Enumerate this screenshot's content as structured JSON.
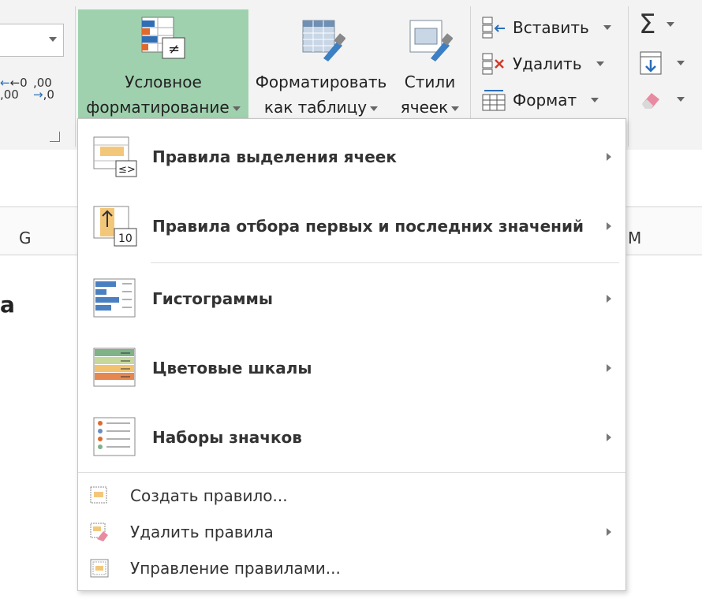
{
  "ribbon": {
    "conditional_formatting": {
      "line1": "Условное",
      "line2": "форматирование"
    },
    "format_as_table": {
      "line1": "Форматировать",
      "line2": "как таблицу"
    },
    "cell_styles": {
      "line1": "Стили",
      "line2": "ячеек"
    },
    "cells": {
      "insert": "Вставить",
      "delete": "Удалить",
      "format": "Формат"
    },
    "decimal_increase": {
      "top": "←0",
      "bottom": ",00"
    },
    "decimal_decrease": {
      "top": ",00",
      "bottom": "→,0"
    },
    "accent_color": "#9fd1ae"
  },
  "sheet": {
    "columns": [
      "G",
      "M"
    ],
    "partial_char": "a"
  },
  "menu": {
    "items": [
      {
        "label": "Правила выделения ячеек",
        "badge": "≤>"
      },
      {
        "label": "Правила отбора первых и последних значений",
        "badge": "10"
      },
      {
        "label": "Гистограммы"
      },
      {
        "label": "Цветовые шкалы"
      },
      {
        "label": "Наборы значков"
      }
    ],
    "actions": [
      {
        "label": "Создать правило..."
      },
      {
        "label": "Удалить правила"
      },
      {
        "label": "Управление правилами..."
      }
    ]
  }
}
